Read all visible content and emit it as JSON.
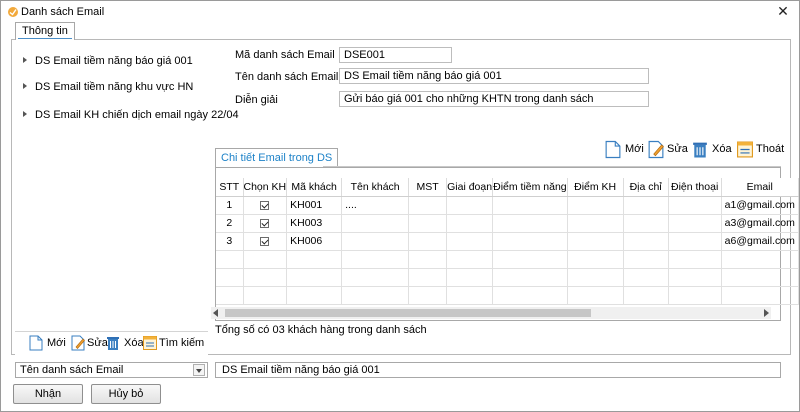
{
  "window": {
    "title": "Danh sách Email",
    "close_glyph": "✕"
  },
  "tabs": {
    "main": "Thông tin"
  },
  "tree": {
    "items": [
      {
        "label": "DS Email tiềm năng báo giá 001"
      },
      {
        "label": "DS Email tiềm năng khu vực HN"
      },
      {
        "label": "DS Email KH chiến dịch email ngày 22/04"
      }
    ],
    "toolbar": {
      "new": "Mới",
      "edit": "Sửa",
      "delete": "Xóa",
      "search": "Tìm kiếm"
    }
  },
  "form": {
    "code_label": "Mã danh sách Email",
    "code_value": "DSE001",
    "name_label": "Tên danh sách Email",
    "name_value": "DS Email tiềm năng báo giá 001",
    "desc_label": "Diễn giải",
    "desc_value": "Gửi báo giá 001 cho những KHTN trong danh sách"
  },
  "detail_toolbar": {
    "new": "Mới",
    "edit": "Sửa",
    "delete": "Xóa",
    "exit": "Thoát"
  },
  "detail": {
    "tab": "Chi tiết Email trong DS",
    "columns": [
      "STT",
      "Chọn KH",
      "Mã khách",
      "Tên khách",
      "MST",
      "Giai đoạn",
      "Điểm tiềm năng",
      "Điểm KH",
      "Địa chỉ",
      "Điện thoại",
      "Email"
    ],
    "rows": [
      {
        "stt": "1",
        "checked": true,
        "code": "KH001",
        "name": "....",
        "email": "a1@gmail.com"
      },
      {
        "stt": "2",
        "checked": true,
        "code": "KH003",
        "name": "",
        "email": "a3@gmail.com"
      },
      {
        "stt": "3",
        "checked": true,
        "code": "KH006",
        "name": "",
        "email": "a6@gmail.com"
      }
    ],
    "summary": "Tổng số có 03 khách hàng trong danh sách"
  },
  "footer": {
    "select_value": "Tên danh sách Email",
    "value_text": "DS Email tiềm năng báo giá 001",
    "ok": "Nhận",
    "cancel": "Hủy bỏ"
  },
  "colors": {
    "accent": "#1d82c8",
    "tab_underline": "#4a8ec8"
  },
  "icons": {
    "app": "app-icon",
    "new": "new-doc-icon",
    "edit": "edit-icon",
    "delete": "trash-icon",
    "search": "search-list-icon",
    "exit": "exit-icon"
  }
}
